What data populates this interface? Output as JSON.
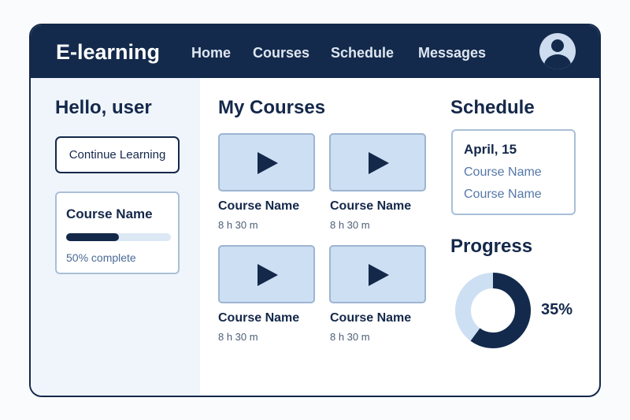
{
  "header": {
    "logo": "E-learning",
    "nav": [
      "Home",
      "Courses",
      "Schedule",
      "Messages"
    ]
  },
  "left": {
    "greeting": "Hello, user",
    "continue_label": "Continue Learning",
    "card": {
      "title": "Course Name",
      "progress_fraction": 0.5,
      "progress_text": "50% complete"
    }
  },
  "courses": {
    "title": "My Courses",
    "items": [
      {
        "name": "Course Name",
        "duration": "8 h 30 m"
      },
      {
        "name": "Course Name",
        "duration": "8 h 30 m"
      },
      {
        "name": "Course Name",
        "duration": "8 h 30 m"
      },
      {
        "name": "Course Name",
        "duration": "8 h 30 m"
      }
    ]
  },
  "schedule": {
    "title": "Schedule",
    "date": "April, 15",
    "items": [
      "Course Name",
      "Course Name"
    ]
  },
  "progress": {
    "title": "Progress",
    "label": "35%",
    "ring_fill_fraction": 0.6
  },
  "colors": {
    "primary": "#132a4c",
    "light": "#cddff2"
  }
}
